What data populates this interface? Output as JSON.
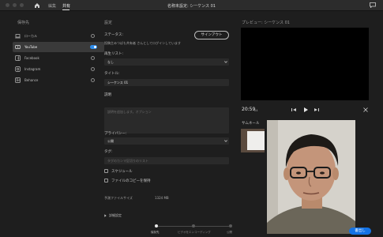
{
  "titlebar": {
    "tabs": [
      {
        "label": "編集",
        "active": false
      },
      {
        "label": "共有",
        "active": true
      }
    ],
    "window_title": "名称未設定: シーケンス 01"
  },
  "sidebar": {
    "heading": "保存先",
    "items": [
      {
        "label": "ローカル",
        "icon": "laptop-icon",
        "control": "radio"
      },
      {
        "label": "YouTube",
        "icon": "youtube-icon",
        "control": "toggle-on"
      },
      {
        "label": "Facebook",
        "icon": "facebook-icon",
        "control": "radio"
      },
      {
        "label": "Instagram",
        "icon": "instagram-icon",
        "control": "radio"
      },
      {
        "label": "Behance",
        "icon": "behance-icon",
        "control": "radio"
      }
    ]
  },
  "settings": {
    "heading": "設定",
    "status_label": "ステータス:",
    "status_text": "投稿主みつばも共有者 さんとしてログインしています",
    "signout_label": "サインアウト",
    "playlist_label": "再生リスト:",
    "playlist_value": "なし",
    "title_label": "タイトル:",
    "title_value": "シーケンス 01",
    "description_label": "説明",
    "description_placeholder": "説明を追加します。オプション",
    "privacy_label": "プライバシー:",
    "privacy_value": "公開",
    "tags_label": "タグ:",
    "tags_placeholder": "タグのカンマ区切りのリスト",
    "schedule_label": "スケジュール",
    "keep_copy_label": "ファイルのコピーを保持",
    "filesize_label": "予測ファイルサイズ",
    "filesize_value": "1324 MB",
    "advanced_label": "詳細設定"
  },
  "preview": {
    "label": "プレビュー: シーケンス 01",
    "timecode": "20:59",
    "fps": "24",
    "thumbnail_label": "サムネール"
  },
  "export_button": "書出し",
  "stepper": {
    "steps": [
      "保存先",
      "ビデオをエンコーディング",
      "公開"
    ],
    "active_index": 0
  },
  "colors": {
    "accent": "#1473e6",
    "toggle_on": "#2d8ceb",
    "background": "#1e1e1e"
  }
}
